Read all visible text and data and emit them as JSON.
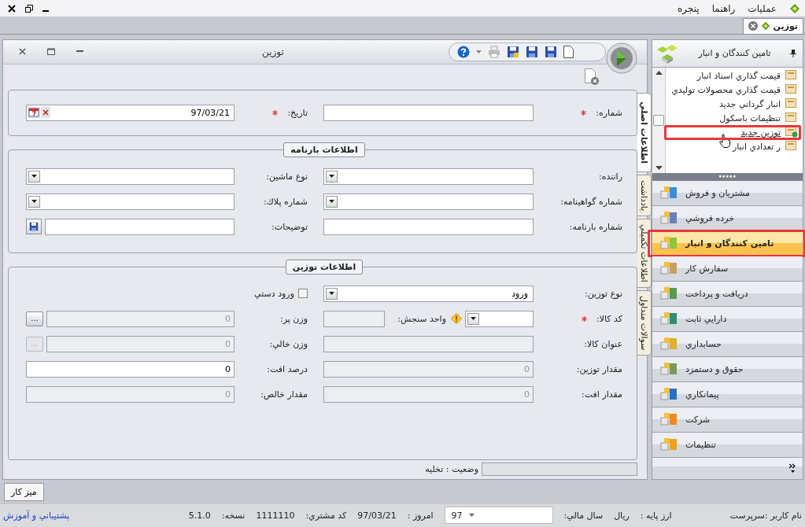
{
  "menu_bar": {
    "items": [
      "عمليات",
      "راهنما",
      "پنجره"
    ]
  },
  "document_tabs": [
    {
      "label": "توزين",
      "selected": true
    }
  ],
  "form_window": {
    "title": "توزين",
    "side_tabs": [
      {
        "label": "اطلاعات اصلي",
        "selected": true
      },
      {
        "label": "يادداشت",
        "selected": false
      },
      {
        "label": "اطلاعات تكميلي",
        "selected": false
      },
      {
        "label": "سوالات متداول",
        "selected": false
      }
    ],
    "header_fields": [
      {
        "label": "شماره:",
        "required": true,
        "kind": "text",
        "disabled": false
      },
      {
        "label": "تاريخ:",
        "required": true,
        "kind": "date",
        "value": "97/03/21",
        "disabled": false
      }
    ],
    "sections": [
      {
        "title": "اطلاعات بارنامه",
        "fields": [
          {
            "label": "راننده:",
            "kind": "dropdown",
            "disabled": false
          },
          {
            "label": "نوع ماشين:",
            "kind": "dropdown",
            "disabled": false
          },
          {
            "label": "شماره گواهينامه:",
            "kind": "dropdown",
            "disabled": false
          },
          {
            "label": "شماره پلاك:",
            "kind": "dropdown",
            "disabled": false
          },
          {
            "label": "شماره بارنامه:",
            "kind": "text",
            "disabled": false
          },
          {
            "label": "توضيحات:",
            "kind": "text_save",
            "disabled": false
          }
        ]
      },
      {
        "title": "اطلاعات توزين",
        "fields": [
          {
            "label": "نوع توزين:",
            "kind": "dropdown",
            "value": "ورود",
            "disabled": false
          },
          {
            "label": "ورود دستي",
            "kind": "checkbox",
            "checked": false
          },
          {
            "label": "كد كالا:",
            "required": true,
            "kind": "dropdown_unit",
            "unit_label": "واحد سنجش:",
            "warning": true,
            "disabled": false
          },
          {
            "label": "وزن پر:",
            "kind": "lookup",
            "value": "0",
            "disabled": true,
            "button_label": "...",
            "button_disabled": false
          },
          {
            "label": "عنوان كالا:",
            "kind": "text",
            "disabled": true
          },
          {
            "label": "وزن خالي:",
            "kind": "lookup",
            "value": "0",
            "disabled": true,
            "button_label": "...",
            "button_disabled": true
          },
          {
            "label": "مقدار توزين:",
            "kind": "text",
            "value": "0",
            "disabled": true
          },
          {
            "label": "درصد افت:",
            "kind": "text",
            "value": "0",
            "disabled": false
          },
          {
            "label": "مقدار افت:",
            "kind": "text",
            "value": "0",
            "disabled": true
          },
          {
            "label": "مقدار خالص:",
            "kind": "text",
            "value": "0",
            "disabled": true
          }
        ]
      }
    ],
    "status": "وضعيت : تخليه"
  },
  "sidebar": {
    "title": "تامين كنندگان و انبار",
    "tasks": [
      {
        "label": "قيمت گذاري اسناد انبار",
        "hovered": false,
        "highlighted": false
      },
      {
        "label": "قيمت گذاري محصولات توليدي",
        "hovered": false,
        "highlighted": false
      },
      {
        "label": "انبار گرداني جديد",
        "hovered": false,
        "highlighted": false
      },
      {
        "label": "تنظيمات باسكول",
        "hovered": false,
        "highlighted": false
      },
      {
        "label": "توزين جديد",
        "hovered": true,
        "highlighted": true
      },
      {
        "label": "ر تعدادي انبار",
        "hovered": false,
        "highlighted": false
      }
    ],
    "modules": [
      {
        "label": "مشتريان و فروش",
        "selected": false,
        "highlighted": false
      },
      {
        "label": "خرده فروشي",
        "selected": false,
        "highlighted": false
      },
      {
        "label": "تامين كنندگان و انبار",
        "selected": true,
        "highlighted": true
      },
      {
        "label": "سفارش كار",
        "selected": false,
        "highlighted": false
      },
      {
        "label": "دريافت و پرداخت",
        "selected": false,
        "highlighted": false
      },
      {
        "label": "دارايي ثابت",
        "selected": false,
        "highlighted": false
      },
      {
        "label": "حسابداري",
        "selected": false,
        "highlighted": false
      },
      {
        "label": "حقوق و دستمزد",
        "selected": false,
        "highlighted": false
      },
      {
        "label": "پيمانكاري",
        "selected": false,
        "highlighted": false
      },
      {
        "label": "شركت",
        "selected": false,
        "highlighted": false
      },
      {
        "label": "تنظيمات",
        "selected": false,
        "highlighted": false
      }
    ]
  },
  "desktop_button": "ميز كار",
  "status_bar": {
    "user_label": "نام كاربر :",
    "user": "سرپرست",
    "currency_label": "ارز پايه :",
    "currency": "ريال",
    "fiscal_year_label": "سال مالي:",
    "fiscal_year": "97",
    "today_label": "امروز :",
    "today": "97/03/21",
    "customer_code_label": "كد مشتري:",
    "customer_code": "1111110",
    "version_label": "نسخه:",
    "version": "5.1.0",
    "support_link": "پشتيباني و آموزش"
  }
}
